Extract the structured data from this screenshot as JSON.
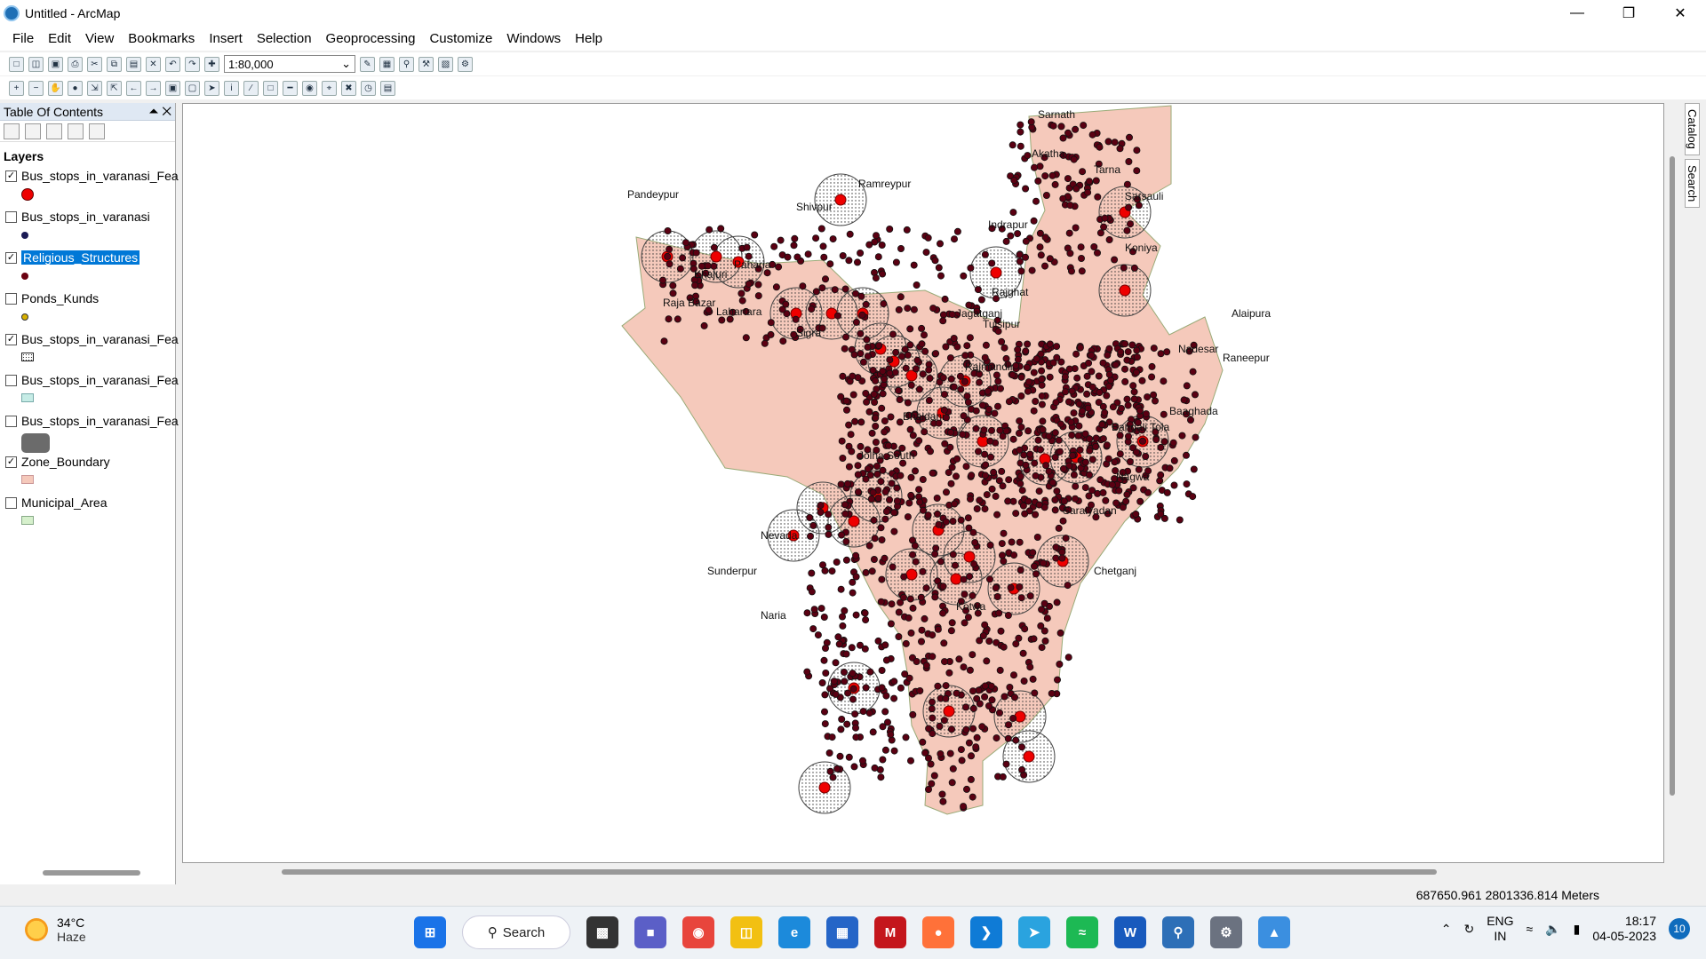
{
  "window": {
    "title": "Untitled - ArcMap"
  },
  "menu": [
    "File",
    "Edit",
    "View",
    "Bookmarks",
    "Insert",
    "Selection",
    "Geoprocessing",
    "Customize",
    "Windows",
    "Help"
  ],
  "toolbar": {
    "scale": "1:80,000"
  },
  "toc": {
    "title": "Table Of Contents",
    "layers_header": "Layers",
    "layers": [
      {
        "name": "Bus_stops_in_varanasi_Fea",
        "checked": true,
        "symbol": "red-circle"
      },
      {
        "name": "Bus_stops_in_varanasi",
        "checked": false,
        "symbol": "navy-dot"
      },
      {
        "name": "Religious_Structures",
        "checked": true,
        "symbol": "dark-red-dot",
        "selected": true
      },
      {
        "name": "Ponds_Kunds",
        "checked": false,
        "symbol": "yellow-dot"
      },
      {
        "name": "Bus_stops_in_varanasi_Fea",
        "checked": true,
        "symbol": "dotted-rect"
      },
      {
        "name": "Bus_stops_in_varanasi_Fea",
        "checked": false,
        "symbol": "cyan-rect"
      },
      {
        "name": "Bus_stops_in_varanasi_Fea",
        "checked": false,
        "symbol": "gray-rect"
      },
      {
        "name": "Zone_Boundary",
        "checked": true,
        "symbol": "pink-rect"
      },
      {
        "name": "Municipal_Area",
        "checked": false,
        "symbol": "green-rect"
      }
    ]
  },
  "map": {
    "labels": [
      "Sarnath",
      "Akatha",
      "Tarna",
      "Sarsauli",
      "Ramreypur",
      "Pandeypur",
      "Shivpur",
      "Indrapur",
      "Paharia",
      "Khajuri",
      "Raja Bazar",
      "Koniya",
      "Alaipura",
      "Nadesar",
      "Rajghat",
      "Jagatganj",
      "Lahartara",
      "Sigra",
      "Rajmandir",
      "Bangali Tola",
      "Tulsipur",
      "Raneepur",
      "Baaghada",
      "Bhaidani",
      "Jolha South",
      "Saraiyadan",
      "Nagwa",
      "Nevada",
      "Sunderpur",
      "Naria",
      "Kotwa",
      "Chetganj"
    ]
  },
  "side_tabs": [
    "Catalog",
    "Search"
  ],
  "status": {
    "coords": "687650.961  2801336.814 Meters"
  },
  "taskbar": {
    "weather_temp": "34°C",
    "weather_desc": "Haze",
    "search_label": "Search",
    "lang1": "ENG",
    "lang2": "IN",
    "time": "18:17",
    "date": "04-05-2023",
    "notifications": "10"
  }
}
